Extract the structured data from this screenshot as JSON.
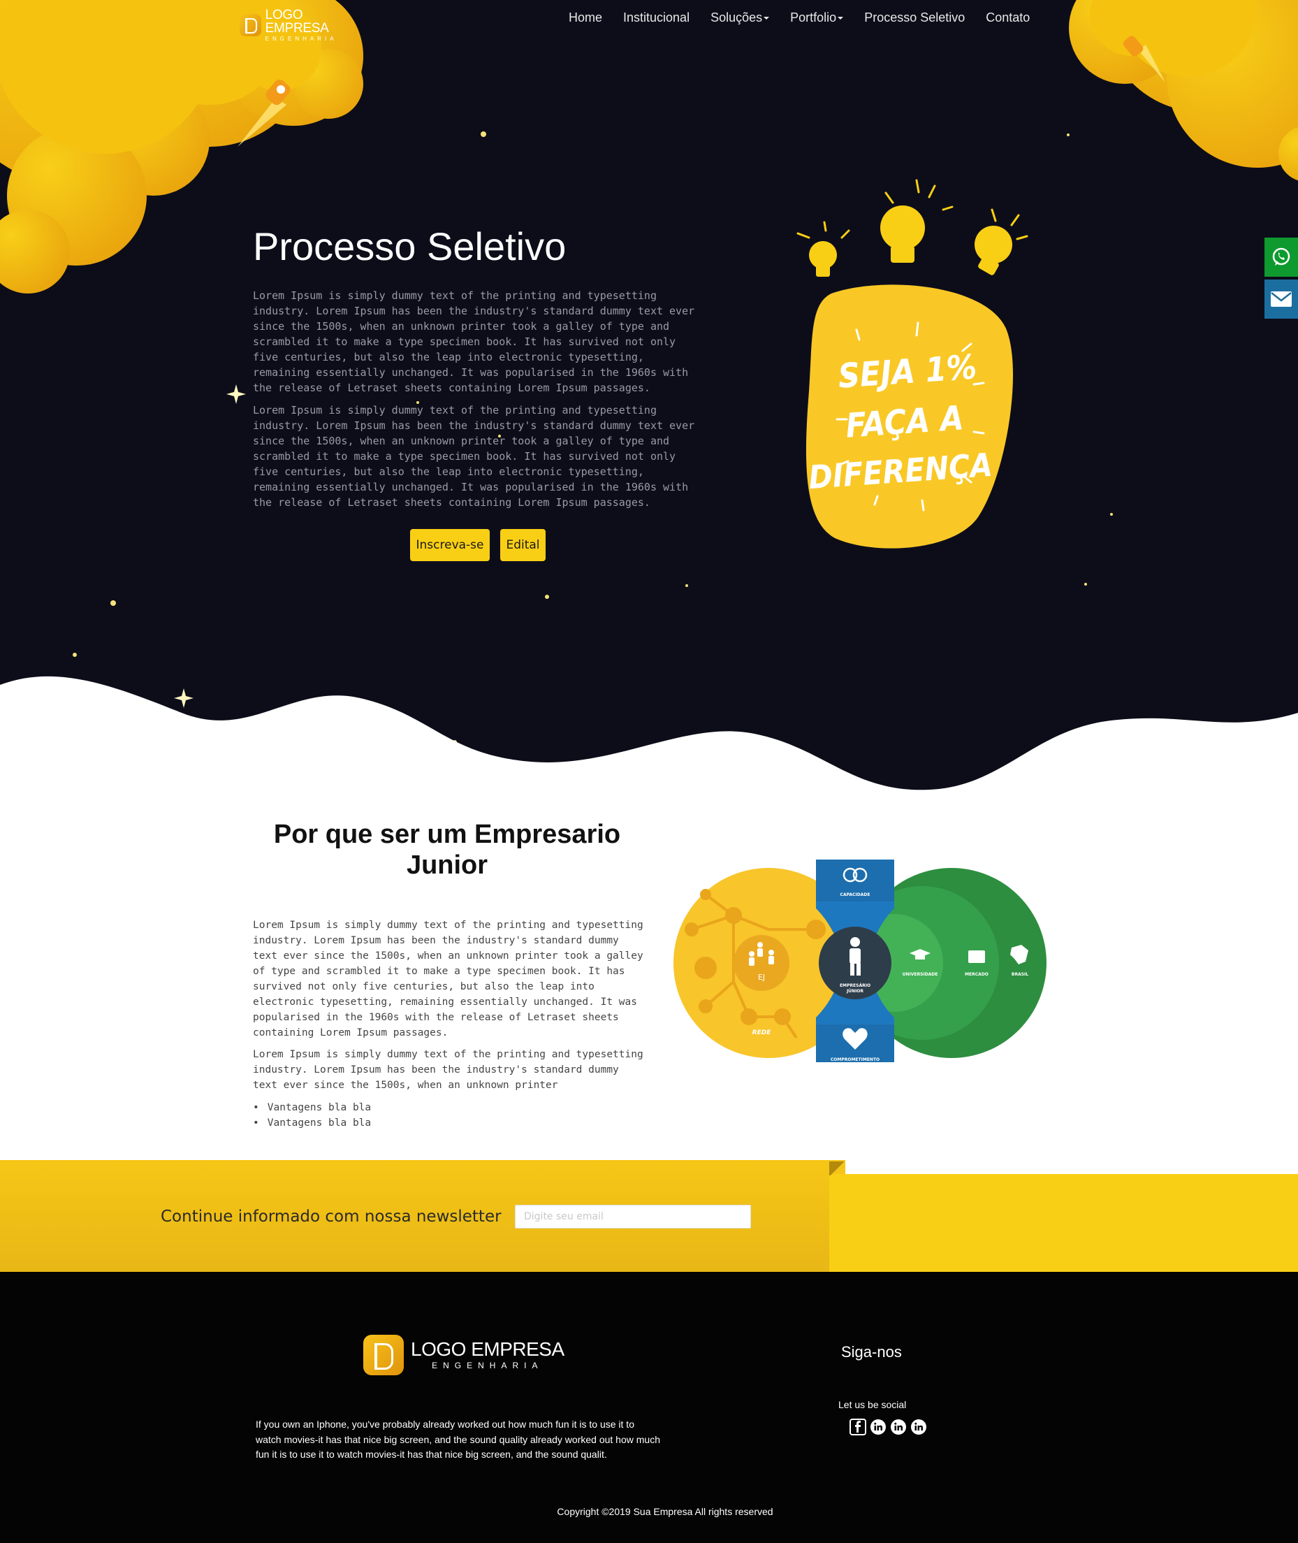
{
  "header": {
    "logo": {
      "name": "LOGO EMPRESA",
      "tagline": "ENGENHARIA"
    },
    "nav": [
      {
        "label": "Home",
        "dropdown": false
      },
      {
        "label": "Institucional",
        "dropdown": false
      },
      {
        "label": "Soluções",
        "dropdown": true
      },
      {
        "label": "Portfolio",
        "dropdown": true
      },
      {
        "label": "Processo Seletivo",
        "dropdown": false
      },
      {
        "label": "Contato",
        "dropdown": false
      }
    ]
  },
  "hero": {
    "title": "Processo Seletivo",
    "paragraphs": [
      "Lorem Ipsum is simply dummy text of the printing and typesetting industry. Lorem Ipsum has been the industry's standard dummy text ever since the 1500s, when an unknown printer took a galley of type and scrambled it to make a type specimen book. It has survived not only five centuries, but also the leap into electronic typesetting, remaining essentially unchanged. It was popularised in the 1960s with the release of Letraset sheets containing Lorem Ipsum passages.",
      "Lorem Ipsum is simply dummy text of the printing and typesetting industry. Lorem Ipsum has been the industry's standard dummy text ever since the 1500s, when an unknown printer took a galley of type and scrambled it to make a type specimen book. It has survived not only five centuries, but also the leap into electronic typesetting, remaining essentially unchanged. It was popularised in the 1960s with the release of Letraset sheets containing Lorem Ipsum passages."
    ],
    "buttons": {
      "inscreva": "Inscreva-se",
      "edital": "Edital"
    },
    "bubble": {
      "line1": "SEJA 1%",
      "line2": "FAÇA A",
      "line3": "DIFERENÇA"
    }
  },
  "side_contacts": {
    "whatsapp_icon": "whatsapp-icon",
    "mail_icon": "mail-icon"
  },
  "section2": {
    "title": "Por que ser um Empresario Junior",
    "paragraphs": [
      "Lorem Ipsum is simply dummy text of the printing and typesetting industry. Lorem Ipsum has been the industry's standard dummy text ever since the 1500s, when an unknown printer took a galley of type and scrambled it to make a type specimen book. It has survived not only five centuries, but also the leap into electronic typesetting, remaining essentially unchanged. It was popularised in the 1960s with the release of Letraset sheets containing Lorem Ipsum passages.",
      "Lorem Ipsum is simply dummy text of the printing and typesetting industry. Lorem Ipsum has been the industry's standard dummy text ever since the 1500s, when an unknown printer"
    ],
    "list": [
      "Vantagens bla bla",
      "Vantagens bla bla"
    ],
    "diagram": {
      "ej": "EJ",
      "rede": "REDE",
      "capacidade": "CAPACIDADE",
      "comprometimento": "COMPROMETIMENTO",
      "center_line1": "EMPRESÁRIO",
      "center_line2": "JÚNIOR",
      "universidade": "UNIVERSIDADE",
      "mercado": "MERCADO",
      "brasil": "BRASIL"
    }
  },
  "newsletter": {
    "label": "Continue informado com nossa newsletter",
    "placeholder": "Digite seu email"
  },
  "footer": {
    "logo": {
      "name": "LOGO EMPRESA",
      "tagline": "ENGENHARIA"
    },
    "text": "If you own an Iphone, you've probably already worked out how much fun it is to use it to watch movies-it has that nice big screen, and the sound quality already worked out how much fun it is to use it to watch movies-it has that nice big screen, and the sound qualit.",
    "follow_title": "Siga-nos",
    "social_text": "Let us be social",
    "social_icons": [
      "facebook-icon",
      "linkedin-icon",
      "linkedin-icon",
      "linkedin-icon"
    ],
    "copyright": "Copyright ©2019 Sua Empresa All rights reserved"
  },
  "colors": {
    "accent": "#f9cf15",
    "hero_bg": "#0d0d1a",
    "footer_bg": "#040404",
    "whatsapp": "#0e9a2e",
    "mail": "#1b6fa0",
    "green": "#2e9a45",
    "blue": "#1e78bf"
  }
}
